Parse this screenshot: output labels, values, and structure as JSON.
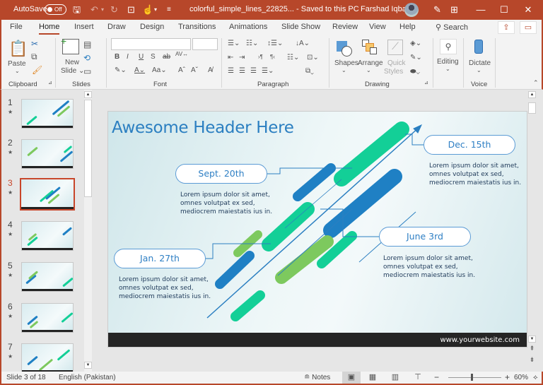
{
  "titlebar": {
    "autosave_label": "AutoSave",
    "autosave_state": "Off",
    "document_title": "colorful_simple_lines_22825...  -  Saved to this PC",
    "user_name": "Farshad Iqbal",
    "icons": [
      "save-icon",
      "undo-icon",
      "redo-icon",
      "present-from-start-icon",
      "touch-mode-icon",
      "customize-qat-icon"
    ],
    "window_controls": {
      "minimize": "—",
      "restore": "☐",
      "close": "✕"
    },
    "accent_color": "#b7472a"
  },
  "tabs": {
    "items": [
      {
        "label": "File"
      },
      {
        "label": "Home",
        "active": true
      },
      {
        "label": "Insert"
      },
      {
        "label": "Draw"
      },
      {
        "label": "Design"
      },
      {
        "label": "Transitions"
      },
      {
        "label": "Animations"
      },
      {
        "label": "Slide Show"
      },
      {
        "label": "Review"
      },
      {
        "label": "View"
      },
      {
        "label": "Help"
      }
    ],
    "search_label": "Search"
  },
  "ribbon": {
    "groups": {
      "clipboard": "Clipboard",
      "slides": "Slides",
      "font": "Font",
      "paragraph": "Paragraph",
      "drawing": "Drawing",
      "voice": "Voice"
    },
    "buttons": {
      "paste": "Paste",
      "new_slide_1": "New",
      "new_slide_2": "Slide",
      "shapes": "Shapes",
      "arrange": "Arrange",
      "quick_styles_1": "Quick",
      "quick_styles_2": "Styles",
      "editing": "Editing",
      "dictate": "Dictate"
    },
    "font_name_value": "",
    "font_size_value": ""
  },
  "thumbnails": [
    {
      "number": "1"
    },
    {
      "number": "2"
    },
    {
      "number": "3",
      "selected": true
    },
    {
      "number": "4"
    },
    {
      "number": "5"
    },
    {
      "number": "6"
    },
    {
      "number": "7"
    }
  ],
  "slide": {
    "title": "Awesome Header Here",
    "milestones": [
      {
        "date": "Sept. 20th",
        "text": [
          "Lorem ipsum dolor sit amet,",
          "omnes volutpat ex sed,",
          "mediocrem maiestatis ius in."
        ]
      },
      {
        "date": "Dec. 15th",
        "text": [
          "Lorem ipsum dolor sit amet,",
          "omnes volutpat ex sed,",
          "mediocrem maiestatis ius in."
        ]
      },
      {
        "date": "Jan. 27th",
        "text": [
          "Lorem ipsum dolor sit amet,",
          "omnes volutpat ex sed,",
          "mediocrem maiestatis ius in."
        ]
      },
      {
        "date": "June 3rd",
        "text": [
          "Lorem ipsum dolor sit amet,",
          "omnes volutpat ex sed,",
          "mediocrem maiestatis ius in."
        ]
      }
    ],
    "website": "www.yourwebsite.com",
    "colors": {
      "blue": "#1f80c4",
      "teal": "#13cf97",
      "green": "#7dc95e",
      "title": "#2b7fc1"
    }
  },
  "statusbar": {
    "slide_info": "Slide 3 of 18",
    "language": "English (Pakistan)",
    "notes_label": "Notes",
    "zoom_level": "60%",
    "zoom_fraction": 0.45
  }
}
